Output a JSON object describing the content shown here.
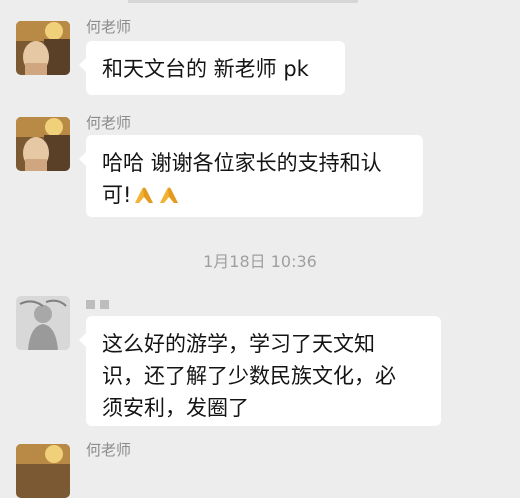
{
  "messages": [
    {
      "sender": "何老师",
      "text": "和天文台的 新老师 pk"
    },
    {
      "sender": "何老师",
      "line1": "哈哈 谢谢各位家长的支持和认",
      "line2": "可!",
      "emoji_icons": [
        "folded-hands-icon",
        "folded-hands-icon"
      ]
    },
    {
      "timestamp": "1月18日 10:36"
    },
    {
      "sender": "",
      "line1": "这么好的游学，学习了天文知",
      "line2": "识，还了解了少数民族文化，必",
      "line3": "须安利，发圈了"
    },
    {
      "sender": "何老师"
    }
  ],
  "colors": {
    "background": "#ededed",
    "bubble": "#ffffff",
    "sender_name": "#8c8c8c",
    "timestamp": "#a0a0a0"
  }
}
